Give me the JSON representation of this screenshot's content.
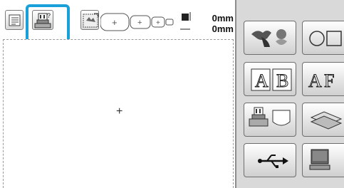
{
  "toolbar": {
    "width_value": "0mm",
    "height_value": "0mm",
    "buttons": [
      "list-icon",
      "embroidery-machine-icon",
      "pattern-edit-icon"
    ]
  },
  "preview": {
    "center_mark": "+"
  },
  "panel": {
    "rows": [
      [
        "embroidery-pattern-bird-icon",
        "frame-pattern-icon"
      ],
      [
        "character-pattern-ab-icon",
        "alphabet-pattern-icon"
      ],
      [
        "machine-memory-icon",
        "pocket-pattern-icon"
      ],
      [
        "usb-icon",
        "computer-icon"
      ]
    ],
    "labels": {
      "ab_left": "A",
      "ab_right": "B",
      "af_left": "A",
      "af_right": "F"
    }
  },
  "colors": {
    "highlight": "#19a0d9",
    "panel_bg": "#d9d9d9"
  }
}
